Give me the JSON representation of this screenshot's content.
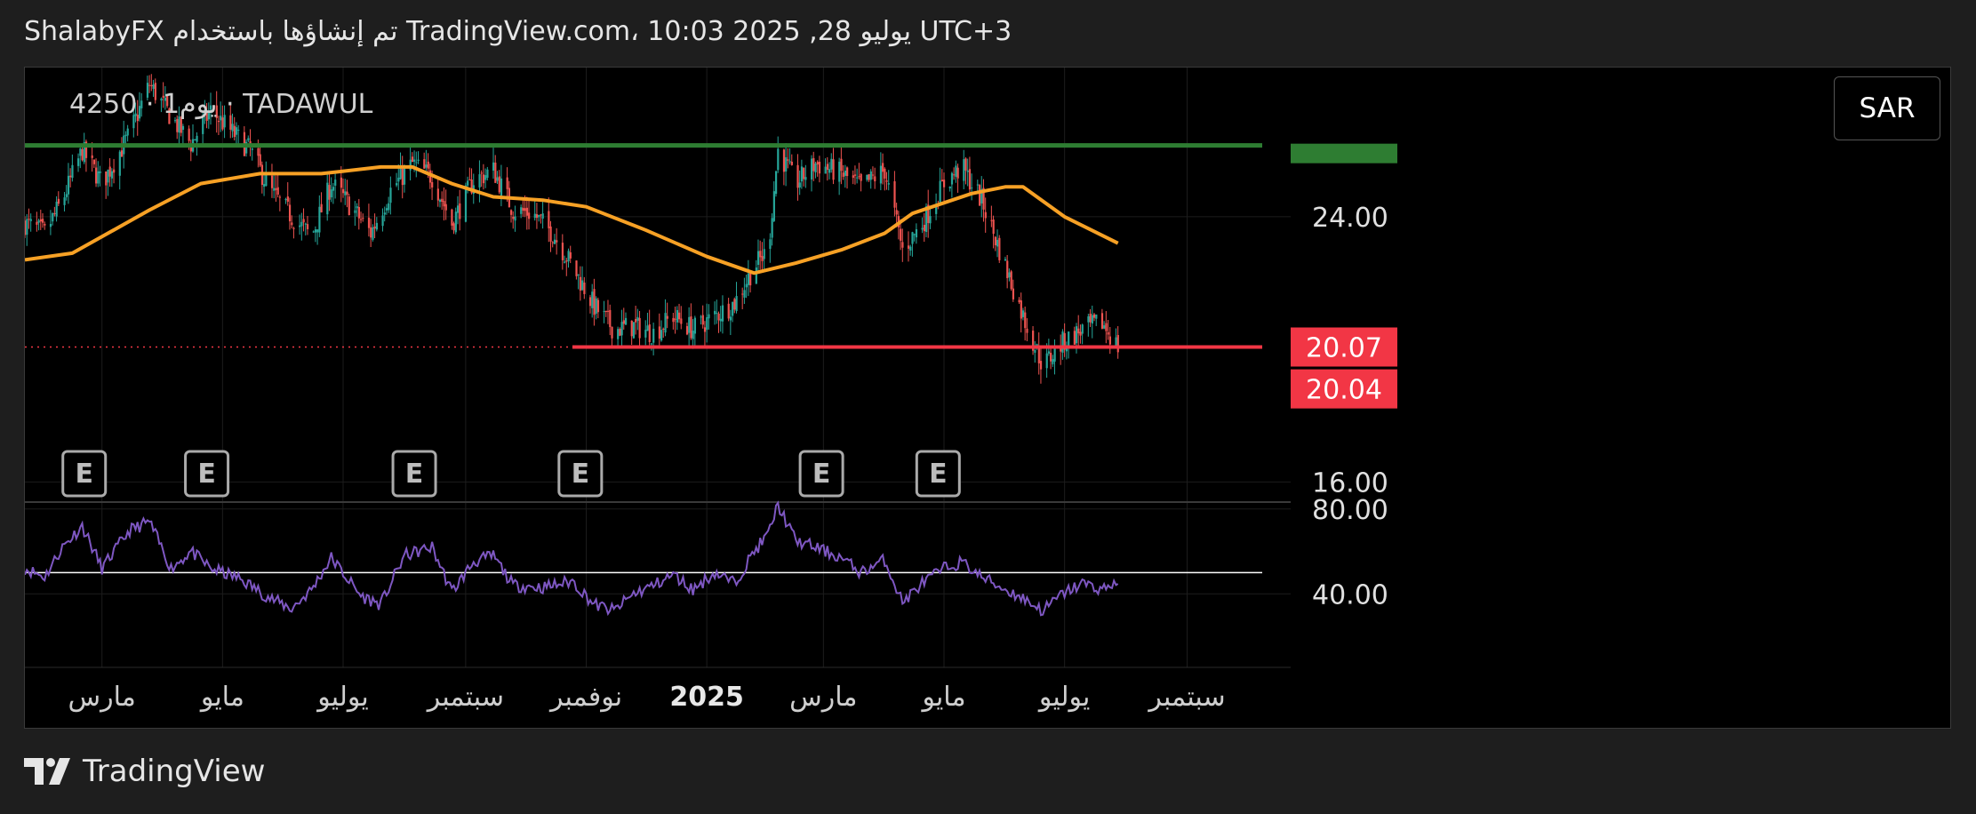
{
  "header": {
    "attribution": "ShalabyFX تم إنشاؤها باستخدام TradingView.com، 10:03 2025 ,28 يوليو UTC+3"
  },
  "symbol": {
    "label": "4250 · 1يوم · TADAWUL"
  },
  "currency": {
    "label": "SAR"
  },
  "footer": {
    "brand": "TradingView"
  },
  "colors": {
    "up": "#26a69a",
    "down": "#ef5350",
    "ma": "#f7a125",
    "rsi": "#7e57c2",
    "resistance": "#2e7d32",
    "support": "#f23645",
    "background": "#000000"
  },
  "chart_data": {
    "type": "candlestick",
    "price_axis": {
      "ticks": [
        24.0,
        16.0
      ],
      "tick_labels": [
        "24.00",
        "16.00"
      ],
      "range": [
        15.5,
        28.5
      ]
    },
    "rsi_axis": {
      "ticks": [
        80.0,
        40.0
      ],
      "tick_labels": [
        "80.00",
        "40.00"
      ],
      "range": [
        20,
        82
      ],
      "midline": 50
    },
    "time_axis": {
      "labels": [
        "مارس",
        "مايو",
        "يوليو",
        "سبتمبر",
        "نوفمبر",
        "2025",
        "مارس",
        "مايو",
        "يوليو",
        "سبتمبر"
      ],
      "dates": [
        "2024-03-01",
        "2024-05-01",
        "2024-07-01",
        "2024-09-01",
        "2024-11-01",
        "2025-01-01",
        "2025-03-01",
        "2025-05-01",
        "2025-07-01",
        "2025-09-01"
      ],
      "range": [
        "2024-01-22",
        "2025-10-09"
      ]
    },
    "price_labels": [
      {
        "text": "20.07",
        "value": 20.07
      },
      {
        "text": "20.04",
        "value": 20.04
      }
    ],
    "resistance": {
      "value": 26.15
    },
    "support": {
      "value": 20.07,
      "start": "2024-10-25",
      "end": "2025-10-09"
    },
    "earnings_markers": {
      "label": "E",
      "dates": [
        "2024-02-21",
        "2024-04-23",
        "2024-08-06",
        "2024-10-29",
        "2025-02-28",
        "2025-04-28"
      ]
    },
    "close_path": [
      [
        "2024-01-22",
        23.8
      ],
      [
        "2024-02-01",
        23.5
      ],
      [
        "2024-02-10",
        24.5
      ],
      [
        "2024-02-20",
        26.0
      ],
      [
        "2024-03-01",
        25.0
      ],
      [
        "2024-03-15",
        26.5
      ],
      [
        "2024-03-25",
        28.0
      ],
      [
        "2024-04-05",
        27.0
      ],
      [
        "2024-04-15",
        26.2
      ],
      [
        "2024-04-25",
        27.2
      ],
      [
        "2024-05-05",
        26.6
      ],
      [
        "2024-05-15",
        26.0
      ],
      [
        "2024-05-25",
        24.8
      ],
      [
        "2024-06-05",
        24.0
      ],
      [
        "2024-06-15",
        23.4
      ],
      [
        "2024-06-25",
        25.0
      ],
      [
        "2024-07-05",
        24.3
      ],
      [
        "2024-07-15",
        23.5
      ],
      [
        "2024-07-25",
        24.8
      ],
      [
        "2024-08-05",
        25.6
      ],
      [
        "2024-08-15",
        25.2
      ],
      [
        "2024-08-25",
        23.8
      ],
      [
        "2024-09-05",
        25.1
      ],
      [
        "2024-09-15",
        25.4
      ],
      [
        "2024-09-25",
        24.2
      ],
      [
        "2024-10-05",
        24.1
      ],
      [
        "2024-10-15",
        23.5
      ],
      [
        "2024-10-25",
        22.5
      ],
      [
        "2024-11-05",
        21.3
      ],
      [
        "2024-11-15",
        20.6
      ],
      [
        "2024-11-25",
        20.7
      ],
      [
        "2024-12-05",
        20.5
      ],
      [
        "2024-12-15",
        21.0
      ],
      [
        "2024-12-25",
        20.6
      ],
      [
        "2025-01-05",
        21.0
      ],
      [
        "2025-01-15",
        21.4
      ],
      [
        "2025-01-25",
        22.5
      ],
      [
        "2025-02-01",
        23.0
      ],
      [
        "2025-02-06",
        26.0
      ],
      [
        "2025-02-15",
        25.0
      ],
      [
        "2025-02-25",
        25.6
      ],
      [
        "2025-03-10",
        25.3
      ],
      [
        "2025-03-20",
        24.9
      ],
      [
        "2025-04-01",
        25.4
      ],
      [
        "2025-04-10",
        23.0
      ],
      [
        "2025-04-20",
        23.8
      ],
      [
        "2025-05-01",
        25.0
      ],
      [
        "2025-05-10",
        25.5
      ],
      [
        "2025-05-20",
        24.5
      ],
      [
        "2025-06-01",
        22.5
      ],
      [
        "2025-06-10",
        21.0
      ],
      [
        "2025-06-20",
        19.5
      ],
      [
        "2025-06-30",
        20.2
      ],
      [
        "2025-07-10",
        20.6
      ],
      [
        "2025-07-20",
        20.8
      ],
      [
        "2025-07-28",
        20.07
      ]
    ],
    "ma_path": [
      [
        "2024-01-22",
        22.7
      ],
      [
        "2024-02-15",
        22.9
      ],
      [
        "2024-03-01",
        23.4
      ],
      [
        "2024-03-25",
        24.2
      ],
      [
        "2024-04-20",
        25.0
      ],
      [
        "2024-05-20",
        25.3
      ],
      [
        "2024-06-20",
        25.3
      ],
      [
        "2024-07-20",
        25.5
      ],
      [
        "2024-08-05",
        25.5
      ],
      [
        "2024-08-25",
        25.0
      ],
      [
        "2024-09-15",
        24.6
      ],
      [
        "2024-10-10",
        24.5
      ],
      [
        "2024-11-01",
        24.3
      ],
      [
        "2024-12-01",
        23.6
      ],
      [
        "2025-01-01",
        22.8
      ],
      [
        "2025-01-25",
        22.3
      ],
      [
        "2025-02-15",
        22.6
      ],
      [
        "2025-03-10",
        23.0
      ],
      [
        "2025-04-01",
        23.5
      ],
      [
        "2025-04-15",
        24.1
      ],
      [
        "2025-05-15",
        24.7
      ],
      [
        "2025-06-01",
        24.9
      ],
      [
        "2025-06-10",
        24.9
      ],
      [
        "2025-07-01",
        24.0
      ],
      [
        "2025-07-28",
        23.2
      ]
    ],
    "rsi_path": [
      [
        "2024-01-22",
        52
      ],
      [
        "2024-02-01",
        48
      ],
      [
        "2024-02-10",
        62
      ],
      [
        "2024-02-20",
        72
      ],
      [
        "2024-03-01",
        52
      ],
      [
        "2024-03-15",
        70
      ],
      [
        "2024-03-25",
        74
      ],
      [
        "2024-04-05",
        52
      ],
      [
        "2024-04-15",
        60
      ],
      [
        "2024-04-25",
        52
      ],
      [
        "2024-05-10",
        47
      ],
      [
        "2024-05-25",
        38
      ],
      [
        "2024-06-05",
        33
      ],
      [
        "2024-06-15",
        42
      ],
      [
        "2024-06-25",
        57
      ],
      [
        "2024-07-10",
        39
      ],
      [
        "2024-07-20",
        35
      ],
      [
        "2024-08-01",
        58
      ],
      [
        "2024-08-15",
        62
      ],
      [
        "2024-08-25",
        41
      ],
      [
        "2024-09-05",
        55
      ],
      [
        "2024-09-15",
        58
      ],
      [
        "2024-09-25",
        44
      ],
      [
        "2024-10-10",
        43
      ],
      [
        "2024-10-25",
        46
      ],
      [
        "2024-11-05",
        35
      ],
      [
        "2024-11-15",
        32
      ],
      [
        "2024-11-25",
        40
      ],
      [
        "2024-12-05",
        44
      ],
      [
        "2024-12-15",
        49
      ],
      [
        "2024-12-25",
        42
      ],
      [
        "2025-01-05",
        50
      ],
      [
        "2025-01-15",
        45
      ],
      [
        "2025-01-25",
        60
      ],
      [
        "2025-02-01",
        68
      ],
      [
        "2025-02-06",
        82
      ],
      [
        "2025-02-15",
        65
      ],
      [
        "2025-02-25",
        62
      ],
      [
        "2025-03-10",
        57
      ],
      [
        "2025-03-20",
        50
      ],
      [
        "2025-04-01",
        56
      ],
      [
        "2025-04-10",
        36
      ],
      [
        "2025-04-20",
        45
      ],
      [
        "2025-05-01",
        52
      ],
      [
        "2025-05-10",
        55
      ],
      [
        "2025-05-20",
        48
      ],
      [
        "2025-06-01",
        42
      ],
      [
        "2025-06-10",
        38
      ],
      [
        "2025-06-20",
        32
      ],
      [
        "2025-06-30",
        40
      ],
      [
        "2025-07-10",
        45
      ],
      [
        "2025-07-20",
        42
      ],
      [
        "2025-07-28",
        46
      ]
    ]
  }
}
